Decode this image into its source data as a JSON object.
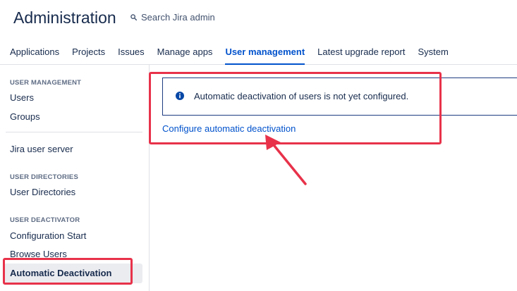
{
  "header": {
    "title": "Administration",
    "search_label": "Search Jira admin",
    "tabs": [
      {
        "label": "Applications"
      },
      {
        "label": "Projects"
      },
      {
        "label": "Issues"
      },
      {
        "label": "Manage apps"
      },
      {
        "label": "User management",
        "active": true
      },
      {
        "label": "Latest upgrade report"
      },
      {
        "label": "System"
      }
    ]
  },
  "sidebar": {
    "section_user_management": "USER MANAGEMENT",
    "users": "Users",
    "groups": "Groups",
    "jira_user_server": "Jira user server",
    "section_user_directories": "USER DIRECTORIES",
    "user_directories": "User Directories",
    "section_user_deactivator": "USER DEACTIVATOR",
    "configuration_start": "Configuration Start",
    "browse_users": "Browse Users",
    "automatic_deactivation": "Automatic Deactivation"
  },
  "main": {
    "info_message": "Automatic deactivation of users is not yet configured.",
    "configure_link": "Configure automatic deactivation"
  },
  "colors": {
    "link": "#0052cc",
    "highlight": "#e8324a",
    "info_border": "#1d3c80"
  },
  "icons": {
    "search": "search-icon",
    "info": "info-icon",
    "annotation_arrow": "red-arrow-icon"
  }
}
